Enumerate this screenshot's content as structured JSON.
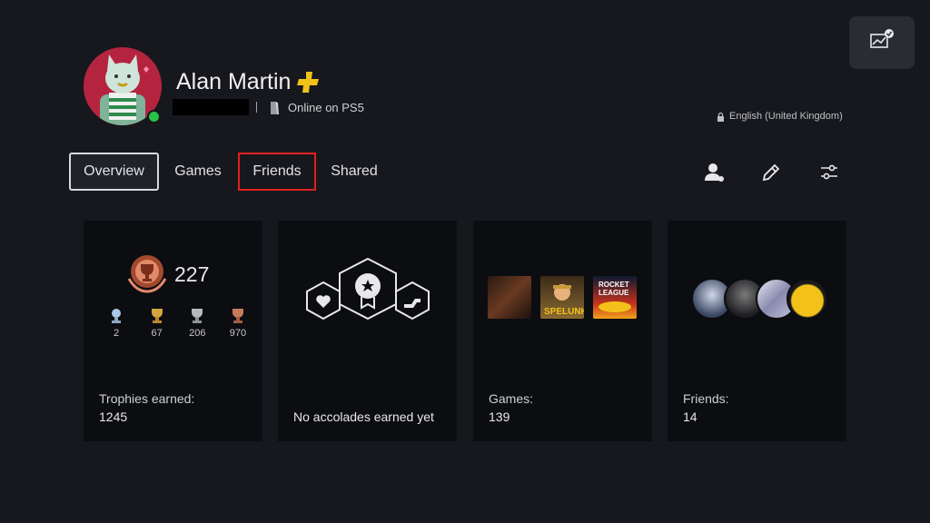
{
  "profile": {
    "name": "Alan Martin",
    "status": "Online on PS5",
    "language": "English (United Kingdom)"
  },
  "tabs": [
    {
      "label": "Overview"
    },
    {
      "label": "Games"
    },
    {
      "label": "Friends"
    },
    {
      "label": "Shared"
    }
  ],
  "cards": {
    "trophies": {
      "label": "Trophies earned:",
      "value": "1245",
      "level": "227",
      "platinum": "2",
      "gold": "67",
      "silver": "206",
      "bronze": "970"
    },
    "accolades": {
      "label": "No accolades earned yet"
    },
    "games": {
      "label": "Games:",
      "value": "139",
      "thumbnails": [
        "game-thumbnail",
        "Spelunky 2",
        "Rocket League"
      ]
    },
    "friends": {
      "label": "Friends:",
      "value": "14"
    }
  },
  "icons": {
    "top_right": "stats-check-icon",
    "plus": "ps-plus-icon",
    "console": "ps5-console-icon",
    "lock": "lock-icon",
    "friend_request": "add-friend-icon",
    "edit": "pencil-icon",
    "settings": "sliders-icon"
  },
  "colors": {
    "background": "#17181d",
    "card": "#0c0d11",
    "plus": "#f2c21b",
    "online": "#29c24a",
    "highlight": "#e02020"
  }
}
